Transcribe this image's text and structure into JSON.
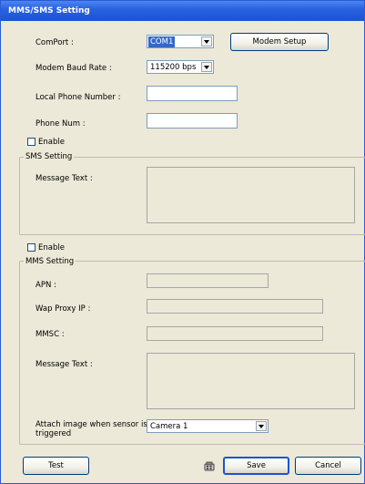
{
  "window": {
    "title": "MMS/SMS Setting"
  },
  "comport": {
    "label": "ComPort :",
    "value": "COM1"
  },
  "modem_setup_label": "Modem Setup",
  "baud": {
    "label": "Modem Baud Rate :",
    "value": "115200 bps"
  },
  "local_phone": {
    "label": "Local Phone Number :",
    "value": ""
  },
  "phone_num": {
    "label": "Phone Num :",
    "value": ""
  },
  "sms": {
    "enable_label": "Enable",
    "group_label": "SMS Setting",
    "message_label": "Message Text :",
    "message_value": ""
  },
  "mms": {
    "enable_label": "Enable",
    "group_label": "MMS Setting",
    "apn_label": "APN :",
    "wap_label": "Wap Proxy IP :",
    "mmsc_label": "MMSC :",
    "message_label": "Message Text :",
    "attach_label_1": "Attach image when sensor is",
    "attach_label_2": "triggered",
    "attach_value": "Camera 1"
  },
  "buttons": {
    "test": "Test",
    "save": "Save",
    "cancel": "Cancel"
  },
  "icons": {
    "phone": "phone-icon"
  },
  "colors": {
    "titlebar": "#2a62e0",
    "selection": "#316ac5",
    "window_bg": "#ece9d8"
  }
}
